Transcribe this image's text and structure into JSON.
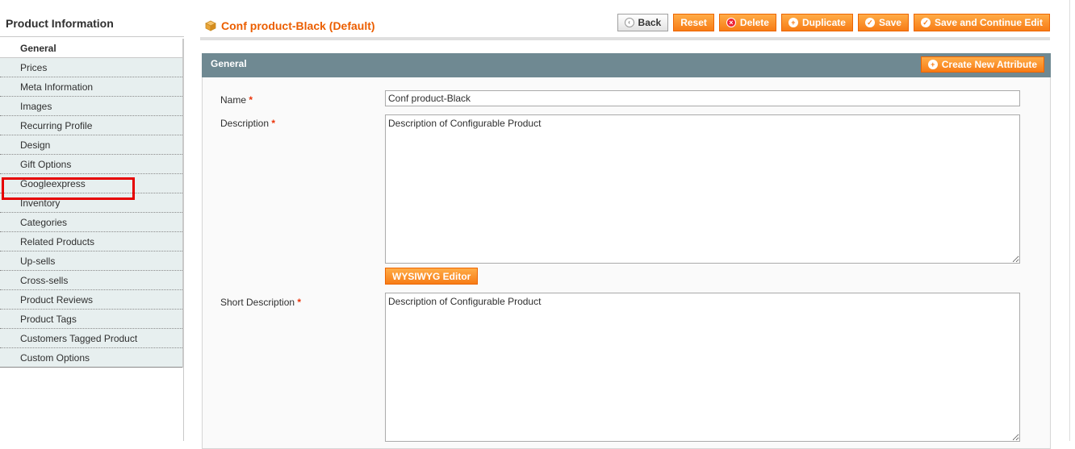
{
  "sidebar": {
    "title": "Product Information",
    "tabs": [
      {
        "label": "General"
      },
      {
        "label": "Prices"
      },
      {
        "label": "Meta Information"
      },
      {
        "label": "Images"
      },
      {
        "label": "Recurring Profile"
      },
      {
        "label": "Design"
      },
      {
        "label": "Gift Options"
      },
      {
        "label": "Googleexpress"
      },
      {
        "label": "Inventory"
      },
      {
        "label": "Categories"
      },
      {
        "label": "Related Products"
      },
      {
        "label": "Up-sells"
      },
      {
        "label": "Cross-sells"
      },
      {
        "label": "Product Reviews"
      },
      {
        "label": "Product Tags"
      },
      {
        "label": "Customers Tagged Product"
      },
      {
        "label": "Custom Options"
      }
    ]
  },
  "header": {
    "title": "Conf product-Black (Default)",
    "buttons": {
      "back": "Back",
      "reset": "Reset",
      "delete": "Delete",
      "duplicate": "Duplicate",
      "save": "Save",
      "save_continue": "Save and Continue Edit"
    }
  },
  "section": {
    "title": "General",
    "create_attribute": "Create New Attribute"
  },
  "form": {
    "name_label": "Name",
    "name_value": "Conf product-Black",
    "description_label": "Description",
    "description_value": "Description of Configurable Product",
    "wysiwyg_label": "WYSIWYG Editor",
    "short_description_label": "Short Description",
    "short_description_value": "Description of Configurable Product",
    "required_mark": "*"
  },
  "colors": {
    "accent": "#eb5e00",
    "section_header": "#6f8992",
    "highlight": "#e60000"
  }
}
